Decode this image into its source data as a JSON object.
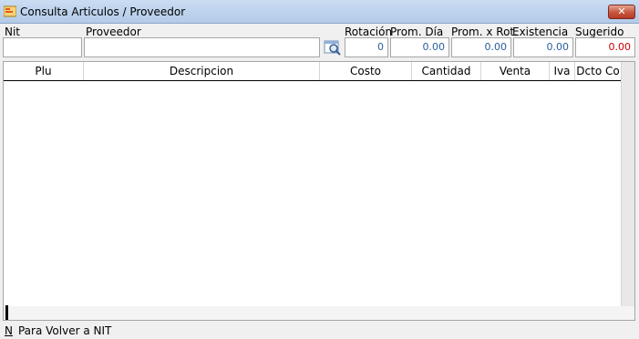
{
  "window": {
    "title": "Consulta Articulos / Proveedor",
    "close_symbol": "✕",
    "icon": "app-icon"
  },
  "labels": {
    "nit": "Nit",
    "proveedor": "Proveedor",
    "rotacion": "Rotación",
    "prom_dia": "Prom. Día",
    "prom_rot": "Prom. x Rot.",
    "existencia": "Existencia",
    "sugerido": "Sugerido"
  },
  "fields": {
    "nit": "",
    "proveedor": "",
    "rotacion": "0",
    "prom_dia": "0.00",
    "prom_rot": "0.00",
    "existencia": "0.00",
    "sugerido": "0.00"
  },
  "colors": {
    "value_blue": "#2a5f9c",
    "value_red": "#d00000",
    "close_red": "#c8553c"
  },
  "grid": {
    "columns": [
      "Plu",
      "Descripcion",
      "Costo",
      "Cantidad",
      "Venta",
      "Iva",
      "Dcto Co"
    ],
    "rows": []
  },
  "status": {
    "key": "N",
    "text": "Para Volver a NIT"
  }
}
